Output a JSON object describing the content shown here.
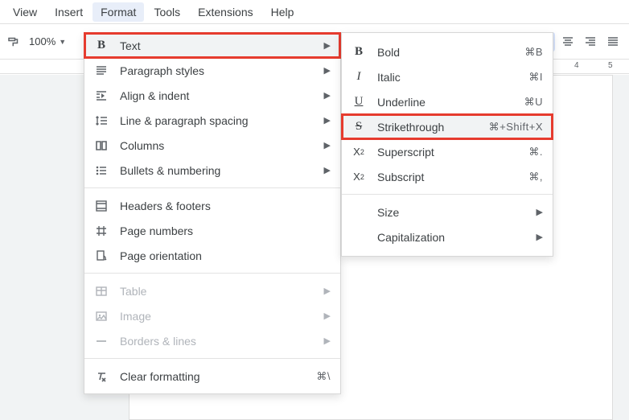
{
  "menubar": {
    "view": "View",
    "insert": "Insert",
    "format": "Format",
    "tools": "Tools",
    "extensions": "Extensions",
    "help": "Help"
  },
  "toolbar": {
    "zoom": "100%"
  },
  "ruler": {
    "n4": "4",
    "n5": "5"
  },
  "formatMenu": {
    "text": "Text",
    "paragraph": "Paragraph styles",
    "align": "Align & indent",
    "lineSpacing": "Line & paragraph spacing",
    "columns": "Columns",
    "bullets": "Bullets & numbering",
    "headers": "Headers & footers",
    "pageNumbers": "Page numbers",
    "pageOrientation": "Page orientation",
    "table": "Table",
    "image": "Image",
    "borders": "Borders & lines",
    "clear": "Clear formatting",
    "clearShortcut": "⌘\\"
  },
  "textMenu": {
    "bold": "Bold",
    "boldSc": "⌘B",
    "italic": "Italic",
    "italicSc": "⌘I",
    "underline": "Underline",
    "underlineSc": "⌘U",
    "strike": "Strikethrough",
    "strikeSc": "⌘+Shift+X",
    "superscript": "Superscript",
    "superscriptSc": "⌘.",
    "subscript": "Subscript",
    "subscriptSc": "⌘,",
    "size": "Size",
    "caps": "Capitalization"
  }
}
